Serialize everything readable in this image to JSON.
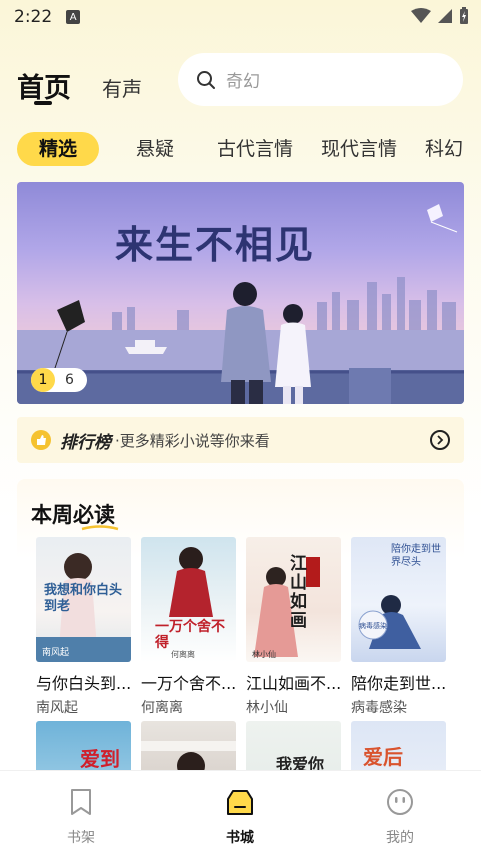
{
  "status_bar": {
    "time": "2:22",
    "a_glyph": "A"
  },
  "header": {
    "tabs": [
      {
        "label": "首页",
        "active": true
      },
      {
        "label": "有声",
        "active": false
      }
    ],
    "search": {
      "placeholder": "奇幻",
      "icon": "search-icon"
    }
  },
  "categories": [
    {
      "label": "精选",
      "active": true
    },
    {
      "label": "悬疑",
      "active": false
    },
    {
      "label": "古代言情",
      "active": false
    },
    {
      "label": "现代言情",
      "active": false
    },
    {
      "label": "科幻",
      "active": false
    }
  ],
  "banner": {
    "title": "来生不相见",
    "current_page": "1",
    "total_pages": "6"
  },
  "ranking": {
    "title": "排行榜",
    "subtitle": "·更多精彩小说等你来看"
  },
  "weekly": {
    "title": "本周必读",
    "books": [
      {
        "title": "与你白头到...",
        "author": "南风起",
        "cover_text": "我想和你白头到老",
        "cover_author": "南风起"
      },
      {
        "title": "一万个舍不...",
        "author": "何离离",
        "cover_text": "一万个舍不得",
        "cover_author": "何离离"
      },
      {
        "title": "江山如画不...",
        "author": "林小仙",
        "cover_text": "江山如画",
        "cover_author": "林小仙"
      },
      {
        "title": "陪你走到世...",
        "author": "病毒感染",
        "cover_text": "陪你走到世界尽头",
        "cover_author": "病毒感染"
      }
    ],
    "more_covers": [
      "爱到",
      "",
      "我爱你",
      "爱后"
    ]
  },
  "bottom_nav": [
    {
      "label": "书架",
      "icon": "bookmark-icon",
      "active": false
    },
    {
      "label": "书城",
      "icon": "bookstore-icon",
      "active": true
    },
    {
      "label": "我的",
      "icon": "profile-icon",
      "active": false
    }
  ],
  "colors": {
    "accent": "#ffd94a",
    "banner_title": "#2d3472"
  }
}
